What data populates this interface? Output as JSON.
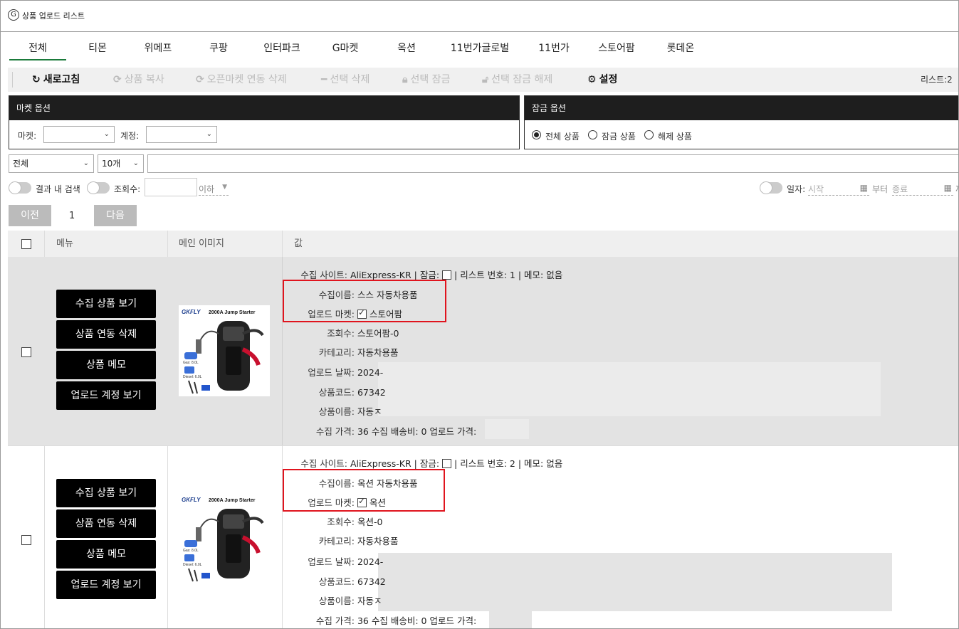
{
  "window": {
    "title": "상품 업로드 리스트",
    "logo_glyph": "G"
  },
  "tabs": [
    {
      "label": "전체",
      "active": true
    },
    {
      "label": "티몬"
    },
    {
      "label": "위메프"
    },
    {
      "label": "쿠팡"
    },
    {
      "label": "인터파크"
    },
    {
      "label": "G마켓"
    },
    {
      "label": "옥션"
    },
    {
      "label": "11번가글로벌"
    },
    {
      "label": "11번가"
    },
    {
      "label": "스토어팜"
    },
    {
      "label": "롯데온"
    }
  ],
  "toolbar": {
    "refresh": "새로고침",
    "copy": "상품 복사",
    "openmarket_delete": "오픈마켓 연동 삭제",
    "delete_selected": "선택 삭제",
    "lock_selected": "선택 잠금",
    "unlock_selected": "선택 잠금 해제",
    "settings": "설정",
    "list_count": "리스트:2"
  },
  "market_options": {
    "title": "마켓 옵션",
    "market_label": "마켓:",
    "market_value": "",
    "account_label": "계정:",
    "account_value": ""
  },
  "lock_options": {
    "title": "잠금 옵션",
    "radios": [
      {
        "label": "전체 상품",
        "checked": true
      },
      {
        "label": "잠금 상품",
        "checked": false
      },
      {
        "label": "해제 상품",
        "checked": false
      }
    ]
  },
  "search": {
    "scope_value": "전체",
    "count_value": "10개",
    "query_value": ""
  },
  "filters": {
    "in_results_label": "결과 내 검색",
    "views_label": "조회수:",
    "views_value": "",
    "views_suffix": "이하",
    "date_label": "일자:",
    "date_start_placeholder": "시작",
    "date_from_label": "부터",
    "date_end_placeholder": "종료",
    "date_tail": "까"
  },
  "pagination": {
    "prev": "이전",
    "page": "1",
    "next": "다음"
  },
  "table": {
    "headers": {
      "menu": "메뉴",
      "main_image": "메인 이미지",
      "value": "값"
    }
  },
  "row_buttons": [
    "수집 상품 보기",
    "상품 연동 삭제",
    "상품 메모",
    "업로드 계정 보기"
  ],
  "rows": [
    {
      "thumb_brand": "GKFLY",
      "thumb_title": "2000A Jump Starter",
      "thumb_gas": "Gas: 8.0L",
      "thumb_diesel": "Diesel: 6.0L",
      "site_label": "수집 사이트:",
      "site_value": "AliExpress-KR",
      "lock_label": "잠금:",
      "list_no_label": "리스트 번호:",
      "list_no": "1",
      "memo_label": "메모:",
      "memo": "없음",
      "collect_name_label": "수집이름:",
      "collect_name": "스스 자동차용품",
      "upload_market_label": "업로드 마켓:",
      "upload_market": "스토어팜",
      "views_label": "조회수:",
      "views": "스토어팜-0",
      "category_label": "카테고리:",
      "category": "자동차용품",
      "upload_date_label": "업로드 날짜:",
      "upload_date": "2024-",
      "code_label": "상품코드:",
      "code": "67342",
      "name_label": "상품이름:",
      "name": "자동ㅈ",
      "price_label": "수집 가격:",
      "price": "36",
      "ship_label": "수집 배송비:",
      "ship": "0",
      "upload_price_label": "업로드 가격:"
    },
    {
      "thumb_brand": "GKFLY",
      "thumb_title": "2000A Jump Starter",
      "thumb_gas": "Gas: 8.0L",
      "thumb_diesel": "Diesel: 6.0L",
      "site_label": "수집 사이트:",
      "site_value": "AliExpress-KR",
      "lock_label": "잠금:",
      "list_no_label": "리스트 번호:",
      "list_no": "2",
      "memo_label": "메모:",
      "memo": "없음",
      "collect_name_label": "수집이름:",
      "collect_name": "옥션 자동차용품",
      "upload_market_label": "업로드 마켓:",
      "upload_market": "옥션",
      "views_label": "조회수:",
      "views": "옥션-0",
      "category_label": "카테고리:",
      "category": "자동차용품",
      "upload_date_label": "업로드 날짜:",
      "upload_date": "2024-",
      "code_label": "상품코드:",
      "code": "67342",
      "name_label": "상품이름:",
      "name": "자동ㅈ",
      "price_label": "수집 가격:",
      "price": "36",
      "ship_label": "수집 배송비:",
      "ship": "0",
      "upload_price_label": "업로드 가격:"
    }
  ],
  "colors": {
    "highlight_box": "#e0141e",
    "row1_bg": "#e3e3e3",
    "header_bg": "#1e1e1e",
    "active_tab": "#1a7a3a"
  },
  "icons": {
    "refresh": "refresh-icon",
    "copy": "sync-icon",
    "delete": "minus-icon",
    "lock": "lock-icon",
    "unlock": "unlock-icon",
    "settings": "gear-icon"
  }
}
